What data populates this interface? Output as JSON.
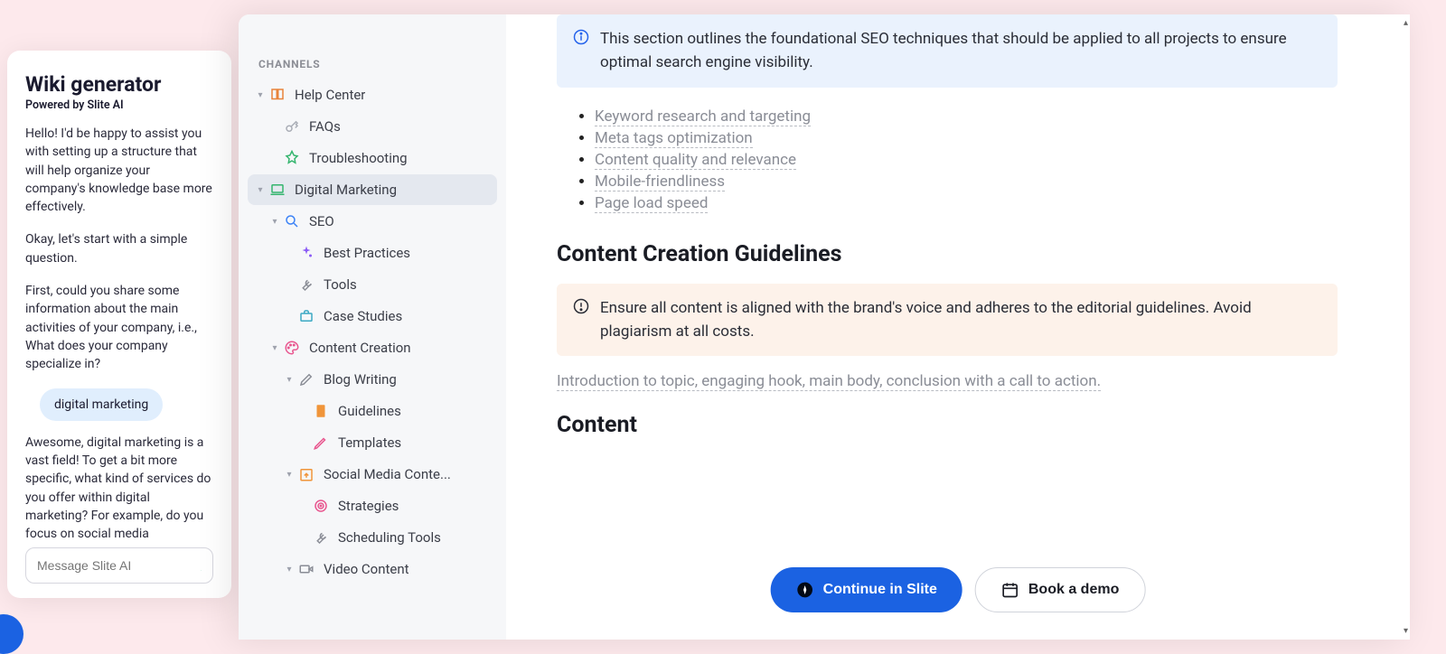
{
  "chat": {
    "title": "Wiki generator",
    "subtitle": "Powered by Slite AI",
    "messages": [
      "Hello! I'd be happy to assist you with setting up a structure that will help organize your company's knowledge base more effectively.",
      "Okay, let's start with a simple question.",
      "First, could you share some information about the main activities of your company, i.e., What does your company specialize in?"
    ],
    "user_message": "digital marketing",
    "followup": "Awesome, digital marketing is a vast field! To get a bit more specific, what kind of services do you offer within digital marketing? For example, do you focus on social media management, SEO, content creation, email marketing, or perhaps a bit of",
    "input_placeholder": "Message Slite AI"
  },
  "sidebar": {
    "section_label": "CHANNELS",
    "items": [
      {
        "label": "Help Center",
        "depth": 0,
        "chevron": true,
        "icon": "book",
        "color": "#e8833a"
      },
      {
        "label": "FAQs",
        "depth": 1,
        "chevron": false,
        "icon": "key",
        "color": "#a9adb6"
      },
      {
        "label": "Troubleshooting",
        "depth": 1,
        "chevron": false,
        "icon": "pin",
        "color": "#34b56e"
      },
      {
        "label": "Digital Marketing",
        "depth": 0,
        "chevron": true,
        "icon": "laptop",
        "color": "#34b56e",
        "selected": true
      },
      {
        "label": "SEO",
        "depth": 1,
        "chevron": true,
        "icon": "search",
        "color": "#3b82f6"
      },
      {
        "label": "Best Practices",
        "depth": 2,
        "chevron": false,
        "icon": "sparkle",
        "color": "#8b5cf6"
      },
      {
        "label": "Tools",
        "depth": 2,
        "chevron": false,
        "icon": "wrench",
        "color": "#8a8d96"
      },
      {
        "label": "Case Studies",
        "depth": 2,
        "chevron": false,
        "icon": "briefcase",
        "color": "#3ba9c4"
      },
      {
        "label": "Content Creation",
        "depth": 1,
        "chevron": true,
        "icon": "palette",
        "color": "#e8568f"
      },
      {
        "label": "Blog Writing",
        "depth": 2,
        "chevron": true,
        "icon": "pen",
        "color": "#8a8d96"
      },
      {
        "label": "Guidelines",
        "depth": 3,
        "chevron": false,
        "icon": "book-solid",
        "color": "#f0953a"
      },
      {
        "label": "Templates",
        "depth": 3,
        "chevron": false,
        "icon": "pencil",
        "color": "#e8568f"
      },
      {
        "label": "Social Media Conte...",
        "depth": 2,
        "chevron": true,
        "icon": "calendar-up",
        "color": "#f0953a"
      },
      {
        "label": "Strategies",
        "depth": 3,
        "chevron": false,
        "icon": "target",
        "color": "#e8568f"
      },
      {
        "label": "Scheduling Tools",
        "depth": 3,
        "chevron": false,
        "icon": "wrench2",
        "color": "#8a8d96"
      },
      {
        "label": "Video Content",
        "depth": 2,
        "chevron": true,
        "icon": "video",
        "color": "#8a8d96"
      }
    ]
  },
  "content": {
    "info_callout": "This section outlines the foundational SEO techniques that should be applied to all projects to ensure optimal search engine visibility.",
    "bullets": [
      "Keyword research and targeting",
      "Meta tags optimization",
      "Content quality and relevance",
      "Mobile-friendliness",
      "Page load speed"
    ],
    "heading1": "Content Creation Guidelines",
    "warn_callout": "Ensure all content is aligned with the brand's voice and adheres to the editorial guidelines. Avoid plagiarism at all costs.",
    "intro_line": "Introduction to topic, engaging hook, main body, conclusion with a call to action.",
    "heading2": "Content"
  },
  "cta": {
    "primary": "Continue in Slite",
    "secondary": "Book a demo"
  }
}
